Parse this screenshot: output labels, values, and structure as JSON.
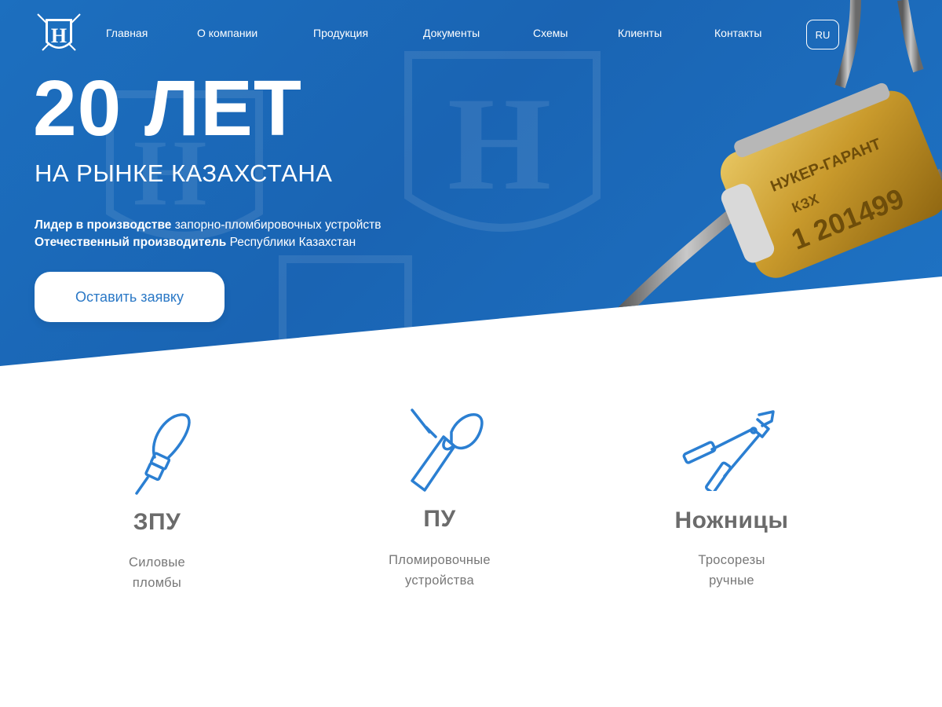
{
  "colors": {
    "primary": "#1c6fbf",
    "accent_blue": "#2a78c6",
    "icon_blue": "#2b7fd2",
    "text_gray": "#6b6b6b",
    "white": "#ffffff"
  },
  "header": {
    "logo_icon": "shield-h-logo-icon",
    "nav": [
      {
        "label": "Главная"
      },
      {
        "label": "О компании"
      },
      {
        "label": "Продукция"
      },
      {
        "label": "Документы"
      },
      {
        "label": "Схемы"
      },
      {
        "label": "Клиенты"
      },
      {
        "label": "Контакты"
      }
    ],
    "lang": "RU"
  },
  "hero": {
    "title": "20 ЛЕТ",
    "subtitle": "НА РЫНКЕ КАЗАХСТАНА",
    "line1_bold": "Лидер в производстве",
    "line1_rest": " запорно-пломбировочных устройств",
    "line2_bold": "Отечественный производитель",
    "line2_rest": " Республики Казахстан",
    "cta": "Оставить заявку",
    "seal_image_icon": "cable-seal-image"
  },
  "products": [
    {
      "icon": "cable-seal-icon",
      "title": "ЗПУ",
      "desc": [
        "Силовые",
        "пломбы"
      ]
    },
    {
      "icon": "plastic-seal-icon",
      "title": "ПУ",
      "desc": [
        "Пломировочные",
        "устройства"
      ]
    },
    {
      "icon": "cable-cutter-icon",
      "title": "Ножницы",
      "desc": [
        "Тросорезы",
        "ручные"
      ]
    }
  ]
}
